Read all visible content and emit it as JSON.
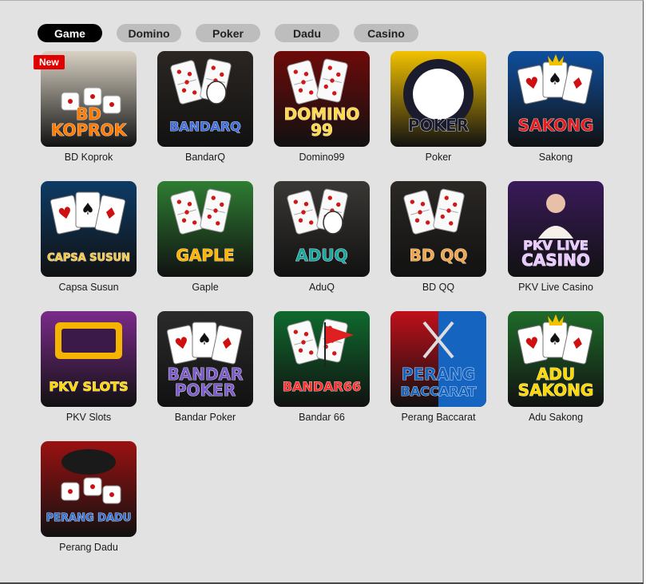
{
  "tabs": [
    {
      "label": "Game",
      "active": true
    },
    {
      "label": "Domino",
      "active": false
    },
    {
      "label": "Poker",
      "active": false
    },
    {
      "label": "Dadu",
      "active": false
    },
    {
      "label": "Casino",
      "active": false
    }
  ],
  "games": [
    {
      "label": "BD Koprok",
      "art_text": "BD\nKOPROK",
      "badge": "New",
      "bg": "#d9d2c4",
      "accent": "#ff7a00",
      "icon": "dice-koprok-icon"
    },
    {
      "label": "BandarQ",
      "art_text": "BANDARQ",
      "bg": "#2b2622",
      "accent": "#3d6de0",
      "icon": "domino-hand-icon"
    },
    {
      "label": "Domino99",
      "art_text": "DOMINO\n99",
      "bg": "#6e0a0a",
      "accent": "#ffd84a",
      "icon": "domino-tiles-icon"
    },
    {
      "label": "Poker",
      "art_text": "POKER",
      "bg": "#f2c200",
      "accent": "#1b1b2e",
      "icon": "poker-chip-icon"
    },
    {
      "label": "Sakong",
      "art_text": "SAKONG",
      "bg": "#0f4f9e",
      "accent": "#e02020",
      "icon": "king-cards-icon"
    },
    {
      "label": "Capsa Susun",
      "art_text": "CAPSA SUSUN",
      "bg": "#0d3b66",
      "accent": "#f5c542",
      "icon": "capsa-cards-icon"
    },
    {
      "label": "Gaple",
      "art_text": "GAPLE",
      "bg": "#2e7d32",
      "accent": "#ffb300",
      "icon": "gaple-domino-icon"
    },
    {
      "label": "AduQ",
      "art_text": "ADUQ",
      "bg": "#3a3835",
      "accent": "#1aa7a0",
      "icon": "domino-hand-icon"
    },
    {
      "label": "BD QQ",
      "art_text": "BD QQ",
      "bg": "#2b2825",
      "accent": "#f0a64a",
      "icon": "domino-tiles-icon"
    },
    {
      "label": "PKV Live Casino",
      "art_text": "PKV LIVE\nCASINO",
      "bg": "#3a1a5a",
      "accent": "#e8c8ff",
      "icon": "live-dealer-icon"
    },
    {
      "label": "PKV Slots",
      "art_text": "PKV SLOTS",
      "bg": "#7a2a8a",
      "accent": "#ffd700",
      "icon": "slot-machine-icon"
    },
    {
      "label": "Bandar Poker",
      "art_text": "BANDAR\nPOKER",
      "bg": "#2b2b2b",
      "accent": "#7b5cc9",
      "icon": "poker-cards-icon"
    },
    {
      "label": "Bandar 66",
      "art_text": "BANDAR66",
      "bg": "#0f6a2e",
      "accent": "#ff3030",
      "icon": "domino-flag-icon"
    },
    {
      "label": "Perang Baccarat",
      "art_text": "PERANG\nBACCARAT",
      "bg": "#c0101a",
      "accent": "#1565c0",
      "icon": "crossed-swords-icon"
    },
    {
      "label": "Adu Sakong",
      "art_text": "ADU\nSAKONG",
      "bg": "#1f6b2a",
      "accent": "#ffd700",
      "icon": "king-cards-icon"
    },
    {
      "label": "Perang Dadu",
      "art_text": "PERANG DADU",
      "bg": "#9b1111",
      "accent": "#2c6fd6",
      "icon": "dice-cup-icon"
    }
  ]
}
